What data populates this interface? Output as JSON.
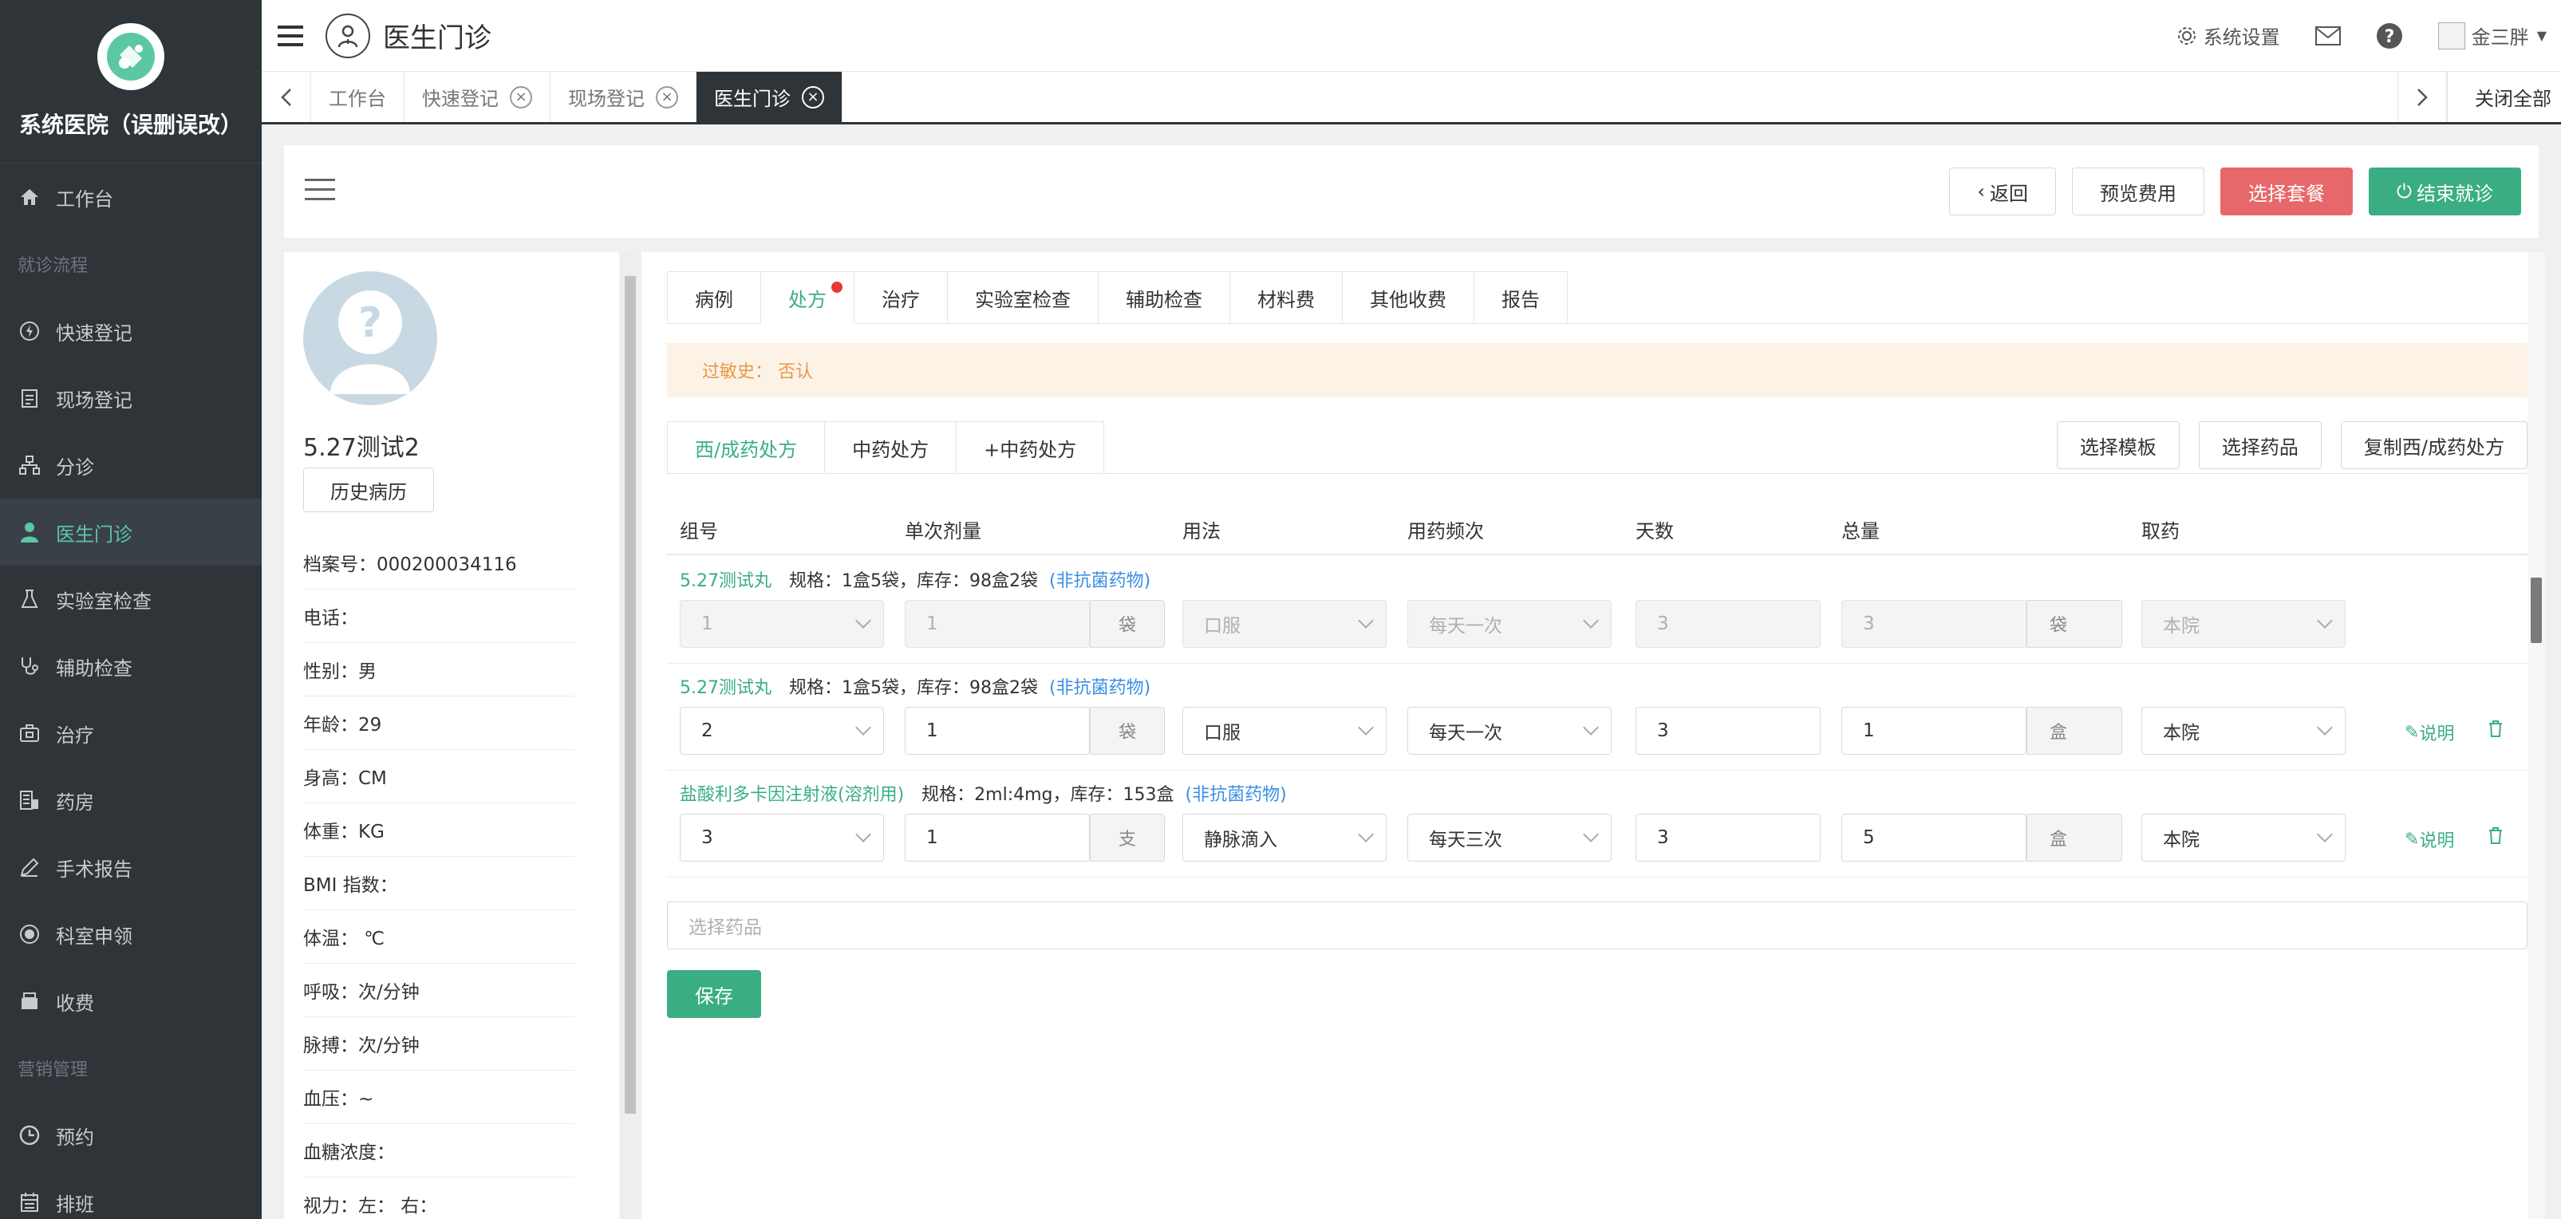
{
  "sidebar": {
    "hospital_name": "系统医院（误删误改）",
    "items": [
      {
        "label": "工作台",
        "icon": "home-icon",
        "type": "item"
      },
      {
        "label": "就诊流程",
        "type": "section"
      },
      {
        "label": "快速登记",
        "icon": "lightning-icon",
        "type": "item"
      },
      {
        "label": "现场登记",
        "icon": "clipboard-icon",
        "type": "item"
      },
      {
        "label": "分诊",
        "icon": "hierarchy-icon",
        "type": "item"
      },
      {
        "label": "医生门诊",
        "icon": "doctor-icon",
        "type": "item",
        "active": true
      },
      {
        "label": "实验室检查",
        "icon": "flask-icon",
        "type": "item"
      },
      {
        "label": "辅助检查",
        "icon": "stethoscope-icon",
        "type": "item"
      },
      {
        "label": "治疗",
        "icon": "medkit-icon",
        "type": "item"
      },
      {
        "label": "药房",
        "icon": "pharmacy-icon",
        "type": "item"
      },
      {
        "label": "手术报告",
        "icon": "pen-icon",
        "type": "item"
      },
      {
        "label": "科室申领",
        "icon": "record-icon",
        "type": "item"
      },
      {
        "label": "收费",
        "icon": "register-icon",
        "type": "item"
      },
      {
        "label": "营销管理",
        "type": "section"
      },
      {
        "label": "预约",
        "icon": "clock-icon",
        "type": "item"
      },
      {
        "label": "排班",
        "icon": "calendar-icon",
        "type": "item"
      }
    ]
  },
  "header": {
    "title": "医生门诊",
    "settings_label": "系统设置",
    "user_name": "金三胖"
  },
  "tabs": {
    "items": [
      {
        "label": "工作台",
        "closable": false
      },
      {
        "label": "快速登记",
        "closable": true
      },
      {
        "label": "现场登记",
        "closable": true
      },
      {
        "label": "医生门诊",
        "closable": true,
        "active": true
      }
    ],
    "close_all": "关闭全部"
  },
  "actions": {
    "back": "返回",
    "preview_fee": "预览费用",
    "select_package": "选择套餐",
    "end_visit": "结束就诊"
  },
  "patient": {
    "name": "5.27测试2",
    "history_btn": "历史病历",
    "info": [
      "档案号：000200034116",
      "电话：",
      "性别：男",
      "年龄：29",
      "身高：CM",
      "体重：KG",
      "BMI 指数：",
      "体温： ℃",
      "呼吸：次/分钟",
      "脉搏：次/分钟",
      "血压：~",
      "血糖浓度：",
      "视力：左：  右："
    ]
  },
  "record_tabs": [
    "病例",
    "处方",
    "治疗",
    "实验室检查",
    "辅助检查",
    "材料费",
    "其他收费",
    "报告"
  ],
  "allergy": "过敏史：  否认",
  "prescription_tabs": [
    "西/成药处方",
    "中药处方",
    "+中药处方"
  ],
  "prescription_buttons": [
    "选择模板",
    "选择药品",
    "复制西/成药处方"
  ],
  "table": {
    "headers": [
      "组号",
      "单次剂量",
      "用法",
      "用药频次",
      "天数",
      "总量",
      "取药"
    ],
    "rows": [
      {
        "drug": "5.27测试丸",
        "spec": "规格：1盒5袋，库存：98盒2袋",
        "tag": "(非抗菌药物)",
        "group": "1",
        "dose": "1",
        "dose_unit": "袋",
        "usage": "口服",
        "freq": "每天一次",
        "days": "3",
        "total": "3",
        "total_unit": "袋",
        "pickup": "本院",
        "disabled": true
      },
      {
        "drug": "5.27测试丸",
        "spec": "规格：1盒5袋，库存：98盒2袋",
        "tag": "(非抗菌药物)",
        "group": "2",
        "dose": "1",
        "dose_unit": "袋",
        "usage": "口服",
        "freq": "每天一次",
        "days": "3",
        "total": "1",
        "total_unit": "盒",
        "pickup": "本院",
        "disabled": false
      },
      {
        "drug": "盐酸利多卡因注射液(溶剂用)",
        "spec": "规格：2ml:4mg，库存：153盒",
        "tag": "(非抗菌药物)",
        "group": "3",
        "dose": "1",
        "dose_unit": "支",
        "usage": "静脉滴入",
        "freq": "每天三次",
        "days": "3",
        "total": "5",
        "total_unit": "盒",
        "pickup": "本院",
        "disabled": false
      }
    ],
    "note_label": "说明"
  },
  "select_drug_placeholder": "选择药品",
  "save_label": "保存",
  "colors": {
    "sidebar_bg": "#2f3439",
    "accent_green": "#3aad83",
    "danger_red": "#e7686a",
    "link_blue": "#3b8ee5",
    "allergy_bg": "#fdf2e6"
  }
}
